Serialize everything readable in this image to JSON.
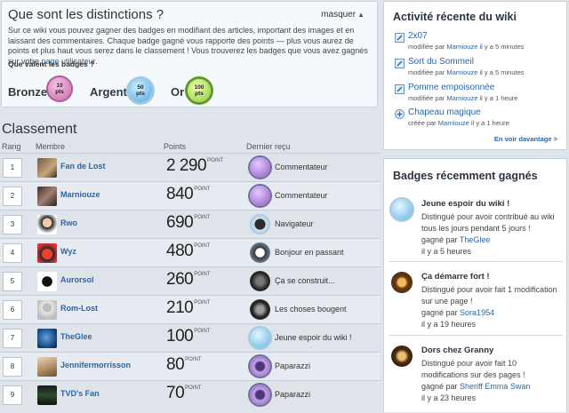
{
  "badge_box": {
    "title": "Que sont les distinctions ?",
    "hide_label": "masquer",
    "intro": "Sur ce wiki vous pouvez gagner des badges en modifiant des articles, important des images et en laissant des commentaires. Chaque badge gagné vous rapporte des points — plus vous aurez de points et plus haut vous serez dans le classement ! Vous trouverez les badges que vous avez gagnés sur votre ",
    "intro_link": "page utilisateur",
    "intro_end": ".",
    "values_question": "Que valent les badges ?",
    "tiers": [
      {
        "label": "Bronze",
        "value": "10",
        "unit": "pts"
      },
      {
        "label": "Argent",
        "value": "50",
        "unit": "pts"
      },
      {
        "label": "Or",
        "value": "100",
        "unit": "pts"
      }
    ]
  },
  "ranking": {
    "title": "Classement",
    "headers": {
      "rank": "Rang",
      "member": "Membre",
      "points": "Points",
      "last": "Dernier reçu"
    },
    "points_unit": "POINT",
    "rows": [
      {
        "rank": "1",
        "name": "Fan de Lost",
        "points": "2 290",
        "last": "Commentateur"
      },
      {
        "rank": "2",
        "name": "Marniouze",
        "points": "840",
        "last": "Commentateur"
      },
      {
        "rank": "3",
        "name": "Rwo",
        "points": "690",
        "last": "Navigateur"
      },
      {
        "rank": "4",
        "name": "Wyz",
        "points": "480",
        "last": "Bonjour en passant"
      },
      {
        "rank": "5",
        "name": "Aurorsol",
        "points": "260",
        "last": "Ça se construit..."
      },
      {
        "rank": "6",
        "name": "Rom-Lost",
        "points": "210",
        "last": "Les choses bougent"
      },
      {
        "rank": "7",
        "name": "TheGlee",
        "points": "100",
        "last": "Jeune espoir du wiki !"
      },
      {
        "rank": "8",
        "name": "Jennifermorrisson",
        "points": "80",
        "last": "Paparazzi"
      },
      {
        "rank": "9",
        "name": "TVD's Fan",
        "points": "70",
        "last": "Paparazzi"
      }
    ]
  },
  "activity": {
    "title": "Activité récente du wiki",
    "items": [
      {
        "title": "2x07",
        "meta_pre": "modifiée par ",
        "user": "Marniouze",
        "meta_post": " il y a 5 minutes"
      },
      {
        "title": "Sort du Sommeil",
        "meta_pre": "modifiée par ",
        "user": "Marniouze",
        "meta_post": " il y a 5 minutes"
      },
      {
        "title": "Pomme empoisonnée",
        "meta_pre": "modifiée par ",
        "user": "Marniouze",
        "meta_post": " il y a 1 heure"
      },
      {
        "title": "Chapeau magique",
        "meta_pre": "créée par ",
        "user": "Marniouze",
        "meta_post": " il y a 1 heure"
      }
    ],
    "see_more": "En voir davantage >"
  },
  "recent_badges": {
    "title": "Badges récemment gagnés",
    "items": [
      {
        "title": "Jeune espoir du wiki !",
        "desc": "Distingué pour avoir contribué au wiki tous les jours pendant 5 jours !",
        "won_by": "gagné par ",
        "user": "TheGlee",
        "ago": "il y a 5 heures"
      },
      {
        "title": "Ça démarre fort !",
        "desc": "Distingué pour avoir fait 1 modification sur une page !",
        "won_by": "gagné par ",
        "user": "Sora1954",
        "ago": "il y a 19 heures"
      },
      {
        "title": "Dors chez Granny",
        "desc": "Distingué pour avoir fait 10 modifications sur des pages !",
        "won_by": "gagné par ",
        "user": "Sheriff Emma Swan",
        "ago": "il y a 23 heures"
      }
    ]
  }
}
